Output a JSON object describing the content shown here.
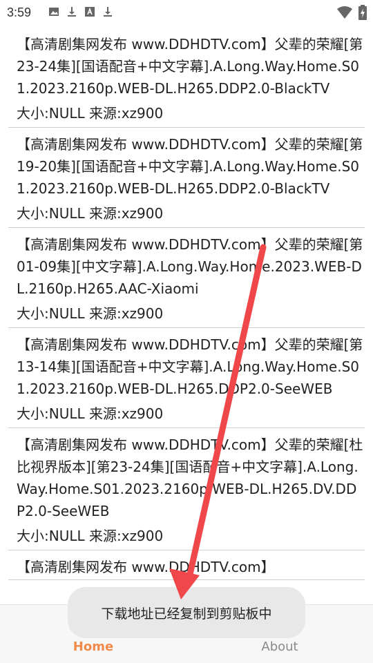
{
  "status_bar": {
    "time": "3:59",
    "icons_left": [
      "image-icon",
      "download-icon",
      "text-icon",
      "download-icon"
    ],
    "icons_right": [
      "wifi-icon",
      "battery-charging-icon"
    ]
  },
  "items": [
    {
      "title": "【高清剧集网发布 www.DDHDTV.com】父辈的荣耀[第23-24集][国语配音+中文字幕].A.Long.Way.Home.S01.2023.2160p.WEB-DL.H265.DDP2.0-BlackTV",
      "meta": "大小:NULL 来源:xz900"
    },
    {
      "title": "【高清剧集网发布 www.DDHDTV.com】父辈的荣耀[第19-20集][国语配音+中文字幕].A.Long.Way.Home.S01.2023.2160p.WEB-DL.H265.DDP2.0-BlackTV",
      "meta": "大小:NULL 来源:xz900"
    },
    {
      "title": "【高清剧集网发布 www.DDHDTV.com】父辈的荣耀[第01-09集][中文字幕].A.Long.Way.Home.2023.WEB-DL.2160p.H265.AAC-Xiaomi",
      "meta": "大小:NULL 来源:xz900"
    },
    {
      "title": "【高清剧集网发布 www.DDHDTV.com】父辈的荣耀[第13-14集][国语配音+中文字幕].A.Long.Way.Home.S01.2023.2160p.WEB-DL.H265.DDP2.0-SeeWEB",
      "meta": "大小:NULL 来源:xz900"
    },
    {
      "title": "【高清剧集网发布 www.DDHDTV.com】父辈的荣耀[杜比视界版本][第23-24集][国语配音+中文字幕].A.Long.Way.Home.S01.2023.2160p.WEB-DL.H265.DV.DDP2.0-SeeWEB",
      "meta": "大小:NULL 来源:xz900"
    },
    {
      "title": "【高清剧集网发布 www.DDHDTV.com】",
      "meta": ""
    }
  ],
  "bottom_nav": {
    "home_label": "Home",
    "about_label": "About",
    "home_icon": "search-icon",
    "about_icon": "person-icon",
    "active_color": "#f08a4b"
  },
  "toast": {
    "text": "下载地址已经复制到剪贴板中"
  },
  "annotation": {
    "arrow_color": "#f0474b"
  }
}
